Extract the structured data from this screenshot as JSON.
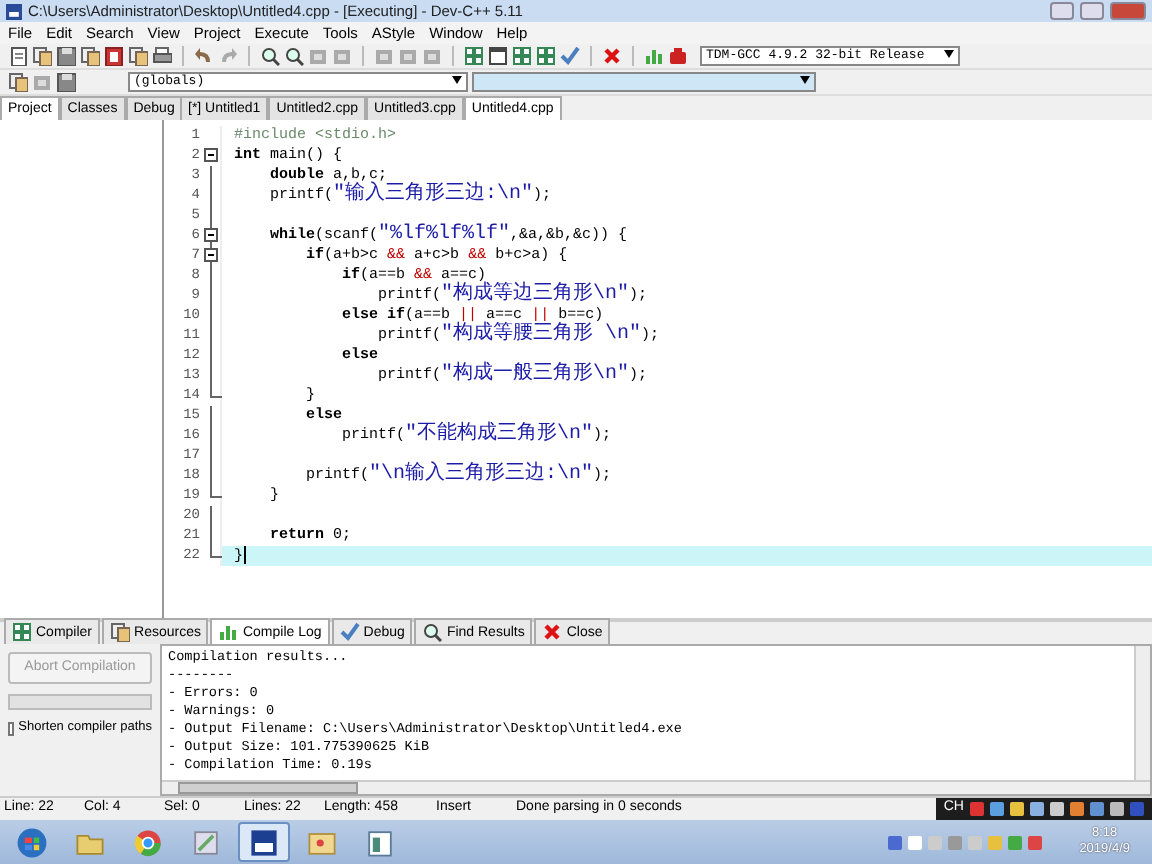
{
  "window": {
    "title": "C:\\Users\\Administrator\\Desktop\\Untitled4.cpp - [Executing] - Dev-C++ 5.11"
  },
  "menu": [
    "File",
    "Edit",
    "Search",
    "View",
    "Project",
    "Execute",
    "Tools",
    "AStyle",
    "Window",
    "Help"
  ],
  "toolbar": {
    "compiler": "TDM-GCC 4.9.2 32-bit Release"
  },
  "toolbar2": {
    "scope": "(globals)"
  },
  "side_tabs": [
    {
      "label": "Project",
      "selected": true
    },
    {
      "label": "Classes",
      "selected": false
    },
    {
      "label": "Debug",
      "selected": false
    }
  ],
  "file_tabs": [
    {
      "label": "[*] Untitled1",
      "selected": false
    },
    {
      "label": "Untitled2.cpp",
      "selected": false
    },
    {
      "label": "Untitled3.cpp",
      "selected": false
    },
    {
      "label": "Untitled4.cpp",
      "selected": true
    }
  ],
  "editor": {
    "lines": [
      {
        "number": "1",
        "tokens": [
          {
            "kind": "preproc",
            "text": "#include <stdio.h>"
          }
        ]
      },
      {
        "number": "2",
        "fold_toggle": true,
        "tokens": [
          {
            "kind": "keyword",
            "text": "int"
          },
          {
            "kind": "plain",
            "text": " main() {"
          }
        ]
      },
      {
        "number": "3",
        "tokens": [
          {
            "kind": "keyword",
            "text": "    double"
          },
          {
            "kind": "plain",
            "text": " a,b,c;"
          }
        ]
      },
      {
        "number": "4",
        "tokens": [
          {
            "kind": "plain",
            "text": "    printf("
          },
          {
            "kind": "string",
            "text": "\"输入三角形三边:\\n\""
          },
          {
            "kind": "plain",
            "text": ");"
          }
        ]
      },
      {
        "number": "5"
      },
      {
        "number": "6",
        "fold_toggle": true,
        "tokens": [
          {
            "kind": "keyword",
            "text": "    while"
          },
          {
            "kind": "plain",
            "text": "(scanf("
          },
          {
            "kind": "string",
            "text": "\"%lf%lf%lf\""
          },
          {
            "kind": "plain",
            "text": ",&a,&b,&c)) {"
          }
        ]
      },
      {
        "number": "7",
        "fold_toggle": true,
        "tokens": [
          {
            "kind": "keyword",
            "text": "        if"
          },
          {
            "kind": "plain",
            "text": "(a+b>c "
          },
          {
            "kind": "symbol",
            "text": "&&"
          },
          {
            "kind": "plain",
            "text": " a+c>b "
          },
          {
            "kind": "symbol",
            "text": "&&"
          },
          {
            "kind": "plain",
            "text": " b+c>a) {"
          }
        ]
      },
      {
        "number": "8",
        "tokens": [
          {
            "kind": "keyword",
            "text": "            if"
          },
          {
            "kind": "plain",
            "text": "(a==b "
          },
          {
            "kind": "symbol",
            "text": "&&"
          },
          {
            "kind": "plain",
            "text": " a==c)"
          }
        ]
      },
      {
        "number": "9",
        "tokens": [
          {
            "kind": "plain",
            "text": "                printf("
          },
          {
            "kind": "string",
            "text": "\"构成等边三角形\\n\""
          },
          {
            "kind": "plain",
            "text": ");"
          }
        ]
      },
      {
        "number": "10",
        "tokens": [
          {
            "kind": "keyword",
            "text": "            else if"
          },
          {
            "kind": "plain",
            "text": "(a==b "
          },
          {
            "kind": "symbol",
            "text": "||"
          },
          {
            "kind": "plain",
            "text": " a==c "
          },
          {
            "kind": "symbol",
            "text": "||"
          },
          {
            "kind": "plain",
            "text": " b==c)"
          }
        ]
      },
      {
        "number": "11",
        "tokens": [
          {
            "kind": "plain",
            "text": "                printf("
          },
          {
            "kind": "string",
            "text": "\"构成等腰三角形 \\n\""
          },
          {
            "kind": "plain",
            "text": ");"
          }
        ]
      },
      {
        "number": "12",
        "tokens": [
          {
            "kind": "keyword",
            "text": "            else"
          }
        ]
      },
      {
        "number": "13",
        "tokens": [
          {
            "kind": "plain",
            "text": "                printf("
          },
          {
            "kind": "string",
            "text": "\"构成一般三角形\\n\""
          },
          {
            "kind": "plain",
            "text": ");"
          }
        ]
      },
      {
        "number": "14",
        "fold_end": true,
        "tokens": [
          {
            "kind": "plain",
            "text": "        }"
          }
        ]
      },
      {
        "number": "15",
        "tokens": [
          {
            "kind": "keyword",
            "text": "        else"
          }
        ]
      },
      {
        "number": "16",
        "tokens": [
          {
            "kind": "plain",
            "text": "            printf("
          },
          {
            "kind": "string",
            "text": "\"不能构成三角形\\n\""
          },
          {
            "kind": "plain",
            "text": ");"
          }
        ]
      },
      {
        "number": "17"
      },
      {
        "number": "18",
        "tokens": [
          {
            "kind": "plain",
            "text": "        printf("
          },
          {
            "kind": "string",
            "text": "\"\\n输入三角形三边:\\n\""
          },
          {
            "kind": "plain",
            "text": ");"
          }
        ]
      },
      {
        "number": "19",
        "fold_end": true,
        "tokens": [
          {
            "kind": "plain",
            "text": "    }"
          }
        ]
      },
      {
        "number": "20"
      },
      {
        "number": "21",
        "tokens": [
          {
            "kind": "keyword",
            "text": "    return"
          },
          {
            "kind": "plain",
            "text": " 0;"
          }
        ]
      },
      {
        "number": "22",
        "fold_end": true,
        "current": true,
        "tokens": [
          {
            "kind": "plain",
            "text": "}"
          }
        ]
      }
    ]
  },
  "bottom_tabs": [
    {
      "label": "Compiler",
      "selected": false
    },
    {
      "label": "Resources",
      "selected": false
    },
    {
      "label": "Compile Log",
      "selected": true
    },
    {
      "label": "Debug",
      "selected": false
    },
    {
      "label": "Find Results",
      "selected": false
    },
    {
      "label": "Close",
      "selected": false
    }
  ],
  "compile_panel": {
    "abort_button": {
      "label": "Abort Compilation",
      "disabled": true
    },
    "progress": {
      "level": 0
    },
    "shorten_paths": {
      "label": "Shorten compiler paths",
      "checked": false
    },
    "log": [
      "Compilation results...",
      "--------",
      "- Errors: 0",
      "- Warnings: 0",
      "- Output Filename: C:\\Users\\Administrator\\Desktop\\Untitled4.exe",
      "- Output Size: 101.775390625 KiB",
      "- Compilation Time: 0.19s"
    ]
  },
  "status_bar": [
    {
      "label": "Line:",
      "value": "22"
    },
    {
      "label": "Col:",
      "value": "4"
    },
    {
      "label": "Sel:",
      "value": "0"
    },
    {
      "label": "Lines:",
      "value": "22"
    },
    {
      "label": "Length:",
      "value": "458"
    },
    {
      "label": "Insert"
    },
    {
      "label": "Done parsing in 0 seconds"
    }
  ],
  "ime_bar": {
    "label": "CH"
  },
  "taskbar": {
    "apps": [
      {
        "kind": "start",
        "selected": false
      },
      {
        "kind": "folder",
        "selected": false
      },
      {
        "kind": "browser",
        "selected": false
      },
      {
        "kind": "tool",
        "selected": false
      },
      {
        "kind": "ide",
        "selected": true
      },
      {
        "kind": "photos",
        "selected": false
      },
      {
        "kind": "window",
        "selected": false
      }
    ],
    "time": "8:18",
    "date": "2019/4/9"
  }
}
